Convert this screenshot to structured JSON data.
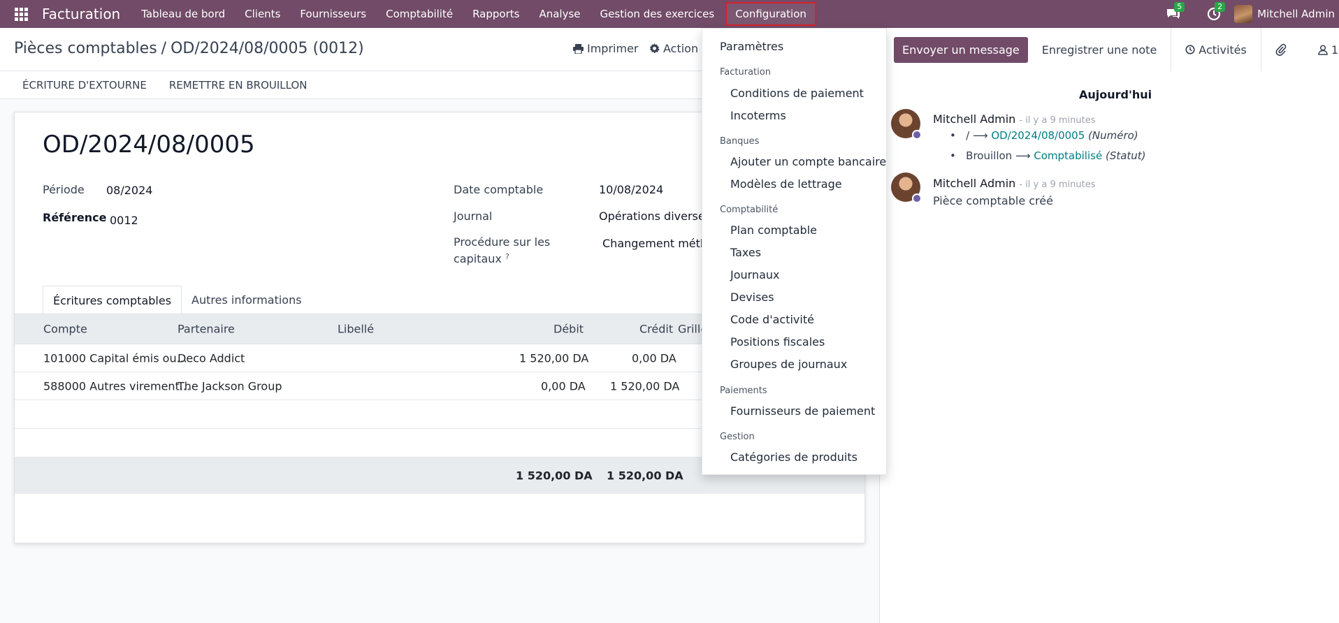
{
  "navbar": {
    "brand": "Facturation",
    "menu": [
      "Tableau de bord",
      "Clients",
      "Fournisseurs",
      "Comptabilité",
      "Rapports",
      "Analyse",
      "Gestion des exercices",
      "Configuration"
    ],
    "messages_count": "5",
    "activities_count": "2",
    "user": "Mitchell Admin",
    "brand_color": "#714b67"
  },
  "breadcrumb": {
    "parent": "Pièces comptables",
    "current": "OD/2024/08/0005 (0012)"
  },
  "control": {
    "print": "Imprimer",
    "action": "Action"
  },
  "status_buttons": [
    "Écriture d'extourne",
    "Remettre en brouillon"
  ],
  "form": {
    "title": "OD/2024/08/0005",
    "periode_label": "Période",
    "periode_value": "08/2024",
    "reference_label": "Référence",
    "reference_value": "0012",
    "date_label": "Date comptable",
    "date_value": "10/08/2024",
    "journal_label": "Journal",
    "journal_value": "Opérations diverses",
    "procedure_label_1": "Procédure sur les",
    "procedure_label_2": "capitaux",
    "procedure_help": "?",
    "procedure_value": "Changement métho"
  },
  "tabs": [
    "Écritures comptables",
    "Autres informations"
  ],
  "table": {
    "headers": {
      "compte": "Compte",
      "partenaire": "Partenaire",
      "libelle": "Libellé",
      "debit": "Débit",
      "credit": "Crédit",
      "grille": "Grille"
    },
    "rows": [
      {
        "compte": "101000 Capital émis ou...",
        "partenaire": "Deco Addict",
        "debit": "1 520,00 DA",
        "credit": "0,00 DA"
      },
      {
        "compte": "588000 Autres virement...",
        "partenaire": "The Jackson Group",
        "debit": "0,00 DA",
        "credit": "1 520,00 DA"
      }
    ],
    "total_debit": "1 520,00 DA",
    "total_credit": "1 520,00 DA"
  },
  "dropdown": {
    "parametres": "Paramètres",
    "facturation_header": "Facturation",
    "conditions": "Conditions de paiement",
    "incoterms": "Incoterms",
    "banques_header": "Banques",
    "ajouter_compte": "Ajouter un compte bancaire",
    "modeles_lettrage": "Modèles de lettrage",
    "comptabilite_header": "Comptabilité",
    "plan": "Plan comptable",
    "taxes": "Taxes",
    "journaux": "Journaux",
    "devises": "Devises",
    "code_activite": "Code d'activité",
    "positions": "Positions fiscales",
    "groupes": "Groupes de journaux",
    "paiements_header": "Paiements",
    "fournisseurs_paiement": "Fournisseurs de paiement",
    "gestion_header": "Gestion",
    "categories": "Catégories de produits"
  },
  "chatter": {
    "send": "Envoyer un message",
    "note": "Enregistrer une note",
    "activities": "Activités",
    "followers": "1",
    "today": "Aujourd'hui",
    "messages": [
      {
        "author": "Mitchell Admin",
        "when": "- il y a 9 minutes",
        "t1_old": "/",
        "t1_new": "OD/2024/08/0005",
        "t1_field": "(Numéro)",
        "t2_old": "Brouillon",
        "t2_new": "Comptabilisé",
        "t2_field": "(Statut)"
      },
      {
        "author": "Mitchell Admin",
        "when": "- il y a 9 minutes",
        "body": "Pièce comptable créé"
      }
    ]
  }
}
